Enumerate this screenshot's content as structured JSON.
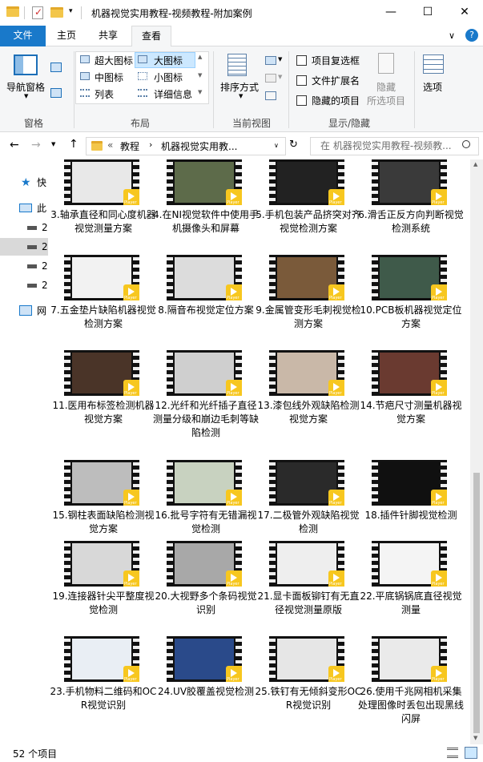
{
  "window": {
    "title": "机器视觉实用教程-视频教程-附加案例",
    "minimize_glyph": "—",
    "maximize_glyph": "☐",
    "close_glyph": "✕"
  },
  "tabs": {
    "file": "文件",
    "home": "主页",
    "share": "共享",
    "view": "查看"
  },
  "ribbon": {
    "nav_pane": "导航窗格",
    "group_pane": "窗格",
    "layout": {
      "extra_large": "超大图标",
      "large": "大图标",
      "medium": "中图标",
      "small": "小图标",
      "list": "列表",
      "details": "详细信息"
    },
    "group_layout": "布局",
    "sort_by": "排序方式",
    "group_current_view": "当前视图",
    "item_checkboxes": "项目复选框",
    "file_extensions": "文件扩展名",
    "hidden_items": "隐藏的项目",
    "hide": "隐藏",
    "hide_selected": "所选项目",
    "options": "选项",
    "group_show_hide": "显示/隐藏"
  },
  "address": {
    "overflow": "«",
    "crumb1": "教程",
    "crumb2": "机器视觉实用教...",
    "search_placeholder": "在 机器视觉实用教程-视频教..."
  },
  "nav": {
    "quick_access": "快",
    "this_pc": "此",
    "network": "网",
    "d1": "2",
    "d2": "2",
    "d3": "2",
    "d4": "2"
  },
  "colors": {
    "accent": "#1979ca",
    "player": "#f7c71f"
  },
  "items": [
    {
      "label": "3.轴承直径和同心度机器视觉测量方案",
      "bg": "#e8e8e8"
    },
    {
      "label": "4.在NI视觉软件中使用手机摄像头和屏幕",
      "bg": "#5d6b4a"
    },
    {
      "label": "5.手机包装产品挤突对齐视觉检测方案",
      "bg": "#222222"
    },
    {
      "label": "6.滑舌正反方向判断视觉检测系统",
      "bg": "#3a3a3a"
    },
    {
      "label": "7.五金垫片缺陷机器视觉检测方案",
      "bg": "#f2f2f2"
    },
    {
      "label": "8.隔音布视觉定位方案",
      "bg": "#dcdcdc"
    },
    {
      "label": "9.金属管变形毛刺视觉检测方案",
      "bg": "#7a5a3a"
    },
    {
      "label": "10.PCB板机器视觉定位方案",
      "bg": "#3f5a4a"
    },
    {
      "label": "11.医用布标签检测机器视觉方案",
      "bg": "#4a3428"
    },
    {
      "label": "12.光纤和光纤插子直径测量分级和崩边毛刺等缺陷检测",
      "bg": "#cfcfcf"
    },
    {
      "label": "13.漆包线外观缺陷检测视觉方案",
      "bg": "#c9b8a8"
    },
    {
      "label": "14.节疤尺寸测量机器视觉方案",
      "bg": "#6a3a30"
    },
    {
      "label": "15.钢柱表面缺陷检测视觉方案",
      "bg": "#bdbdbd"
    },
    {
      "label": "16.批号字符有无错漏视觉检测",
      "bg": "#c8d2c0"
    },
    {
      "label": "17.二极管外观缺陷视觉检测",
      "bg": "#2a2a2a"
    },
    {
      "label": "18.插件针脚视觉检测",
      "bg": "#101010"
    },
    {
      "label": "19.连接器针尖平整度视觉检测",
      "bg": "#d8d8d8"
    },
    {
      "label": "20.大视野多个条码视觉识别",
      "bg": "#a8a8a8"
    },
    {
      "label": "21.显卡面板铆钉有无直径视觉测量原版",
      "bg": "#eeeeee"
    },
    {
      "label": "22.平底锅锅底直径视觉测量",
      "bg": "#f4f4f4"
    },
    {
      "label": "23.手机物料二维码和OCR视觉识别",
      "bg": "#e9eef4"
    },
    {
      "label": "24.UV胶覆盖视觉检测",
      "bg": "#2a4a8a"
    },
    {
      "label": "25.铁钉有无倾斜变形OCR视觉识别",
      "bg": "#e6e6e6"
    },
    {
      "label": "26.使用千兆网相机采集处理图像时丢包出现黑线闪屏",
      "bg": "#eaeaea"
    }
  ],
  "player_badge": "Player",
  "status": {
    "count": "52 个项目"
  }
}
